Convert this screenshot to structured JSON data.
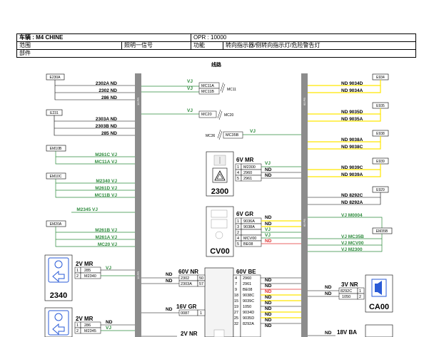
{
  "header": {
    "vehicle_label": "车辆 : M4 CHINE",
    "opr_label": "OPR : 10000",
    "scope_label": "范围",
    "lighting_label": "照明一信号",
    "function_label": "功能",
    "function_value": "转向指示器/侧转向指示灯/危险警告灯",
    "part_label": "部件"
  },
  "section_label": "线路",
  "bus_labels": {
    "left": "10 PR",
    "left2": "10 PR",
    "right": "60 PB",
    "right2": "60 PB"
  },
  "connectors_left": [
    {
      "box": "E230A",
      "lines": [
        "2302A ND",
        "2302 ND",
        "286 ND"
      ]
    },
    {
      "box": "E231",
      "lines": [
        "2303A ND",
        "2303B ND",
        "285 ND"
      ]
    },
    {
      "box": "EM10B",
      "lines": [
        "M261C VJ",
        "MC11A VJ"
      ]
    },
    {
      "box": "EM10C",
      "lines": [
        "M2340 VJ",
        "M261D VJ",
        "MC11B VJ"
      ]
    },
    {
      "box": "",
      "lines": [
        "M2345 VJ"
      ]
    },
    {
      "box": "EM20A",
      "lines": [
        "M261B VJ",
        "M261A VJ",
        "MC20 VJ"
      ]
    }
  ],
  "connectors_right": [
    {
      "box": "E934",
      "lines": [
        "ND 9034D",
        "ND 9034A"
      ]
    },
    {
      "box": "E935",
      "lines": [
        "ND 9035D",
        "ND 9035A"
      ]
    },
    {
      "box": "E938",
      "lines": [
        "ND 9038A",
        "ND 9038C"
      ]
    },
    {
      "box": "E939",
      "lines": [
        "ND 9039C",
        "ND 9039A"
      ]
    },
    {
      "box": "E929",
      "lines": [
        "ND 8292C",
        "ND 8292A"
      ]
    },
    {
      "box": "EM35B",
      "lines": [
        "VJ M0004",
        "VJ MC35B",
        "VJ MCV00",
        "VJ M2300"
      ]
    }
  ],
  "splices": {
    "mc11": {
      "wire": "VJ",
      "rows": [
        "MC11A",
        "MC11B"
      ],
      "label": "MC11"
    },
    "mc20": {
      "wire": "VJ",
      "rows": [
        "MC20"
      ],
      "label": "MC20"
    },
    "mc35": {
      "wire": "VJ",
      "rows": [
        "MC35B"
      ],
      "label": "MC36"
    }
  },
  "component_2300": {
    "id": "2300",
    "connector": "6V MR",
    "pins": [
      [
        "1",
        "M2300",
        "VJ"
      ],
      [
        "4",
        "2960",
        "ND"
      ],
      [
        "5",
        "2961",
        "ND"
      ]
    ]
  },
  "component_cv00": {
    "id": "CV00",
    "connector": "6V GR",
    "pins": [
      [
        "1",
        "9036A",
        "ND"
      ],
      [
        "3",
        "9038A",
        "ND"
      ],
      [
        "2",
        "",
        "VJ"
      ],
      [
        "4",
        "MCV00",
        "VJ"
      ],
      [
        "5",
        "BE08",
        "ND"
      ]
    ]
  },
  "component_2340": {
    "id": "2340",
    "connector": "2V MR",
    "pins": [
      [
        "1",
        "285",
        "VJ"
      ],
      [
        "2",
        "M2340",
        ""
      ]
    ]
  },
  "component_2345": {
    "connector": "2V MR",
    "pins": [
      [
        "1",
        "286",
        "ND"
      ],
      [
        "2",
        "M2345",
        "VJ"
      ]
    ]
  },
  "bsi_left": {
    "connector": "60V NR",
    "pins": [
      [
        "50",
        "2302",
        "ND"
      ],
      [
        "57",
        "2303A",
        "ND"
      ]
    ],
    "connector2": "16V GR",
    "pins2": [
      [
        "1",
        "0087",
        "ND"
      ]
    ],
    "connector3": "2V NR"
  },
  "bsi_right": {
    "connector": "60V BE",
    "pins": [
      [
        "4",
        "2960",
        "ND"
      ],
      [
        "7",
        "2961",
        "ND"
      ],
      [
        "9",
        "BE08",
        "ND"
      ],
      [
        "18",
        "9038C",
        "ND"
      ],
      [
        "15",
        "9039C",
        "ND"
      ],
      [
        "19",
        "1050",
        "ND"
      ],
      [
        "27",
        "9034D",
        "ND"
      ],
      [
        "25",
        "9035D",
        "ND"
      ],
      [
        "32",
        "8292A",
        "ND"
      ]
    ],
    "left_wires": [
      "ND",
      "ND",
      "ND",
      "ND"
    ]
  },
  "component_ca00": {
    "id": "CA00",
    "connector": "3V NR",
    "pins": [
      [
        "1",
        "8292C",
        "ND"
      ],
      [
        "2",
        "1050",
        "ND"
      ]
    ]
  },
  "connector_18v": {
    "connector": "18V BA",
    "wire": "ND"
  },
  "colors": {
    "yellow": "#ffe600",
    "green": "#2e8b3d",
    "red": "#e03030",
    "bus": "#8c8c8c",
    "line": "#000000"
  }
}
